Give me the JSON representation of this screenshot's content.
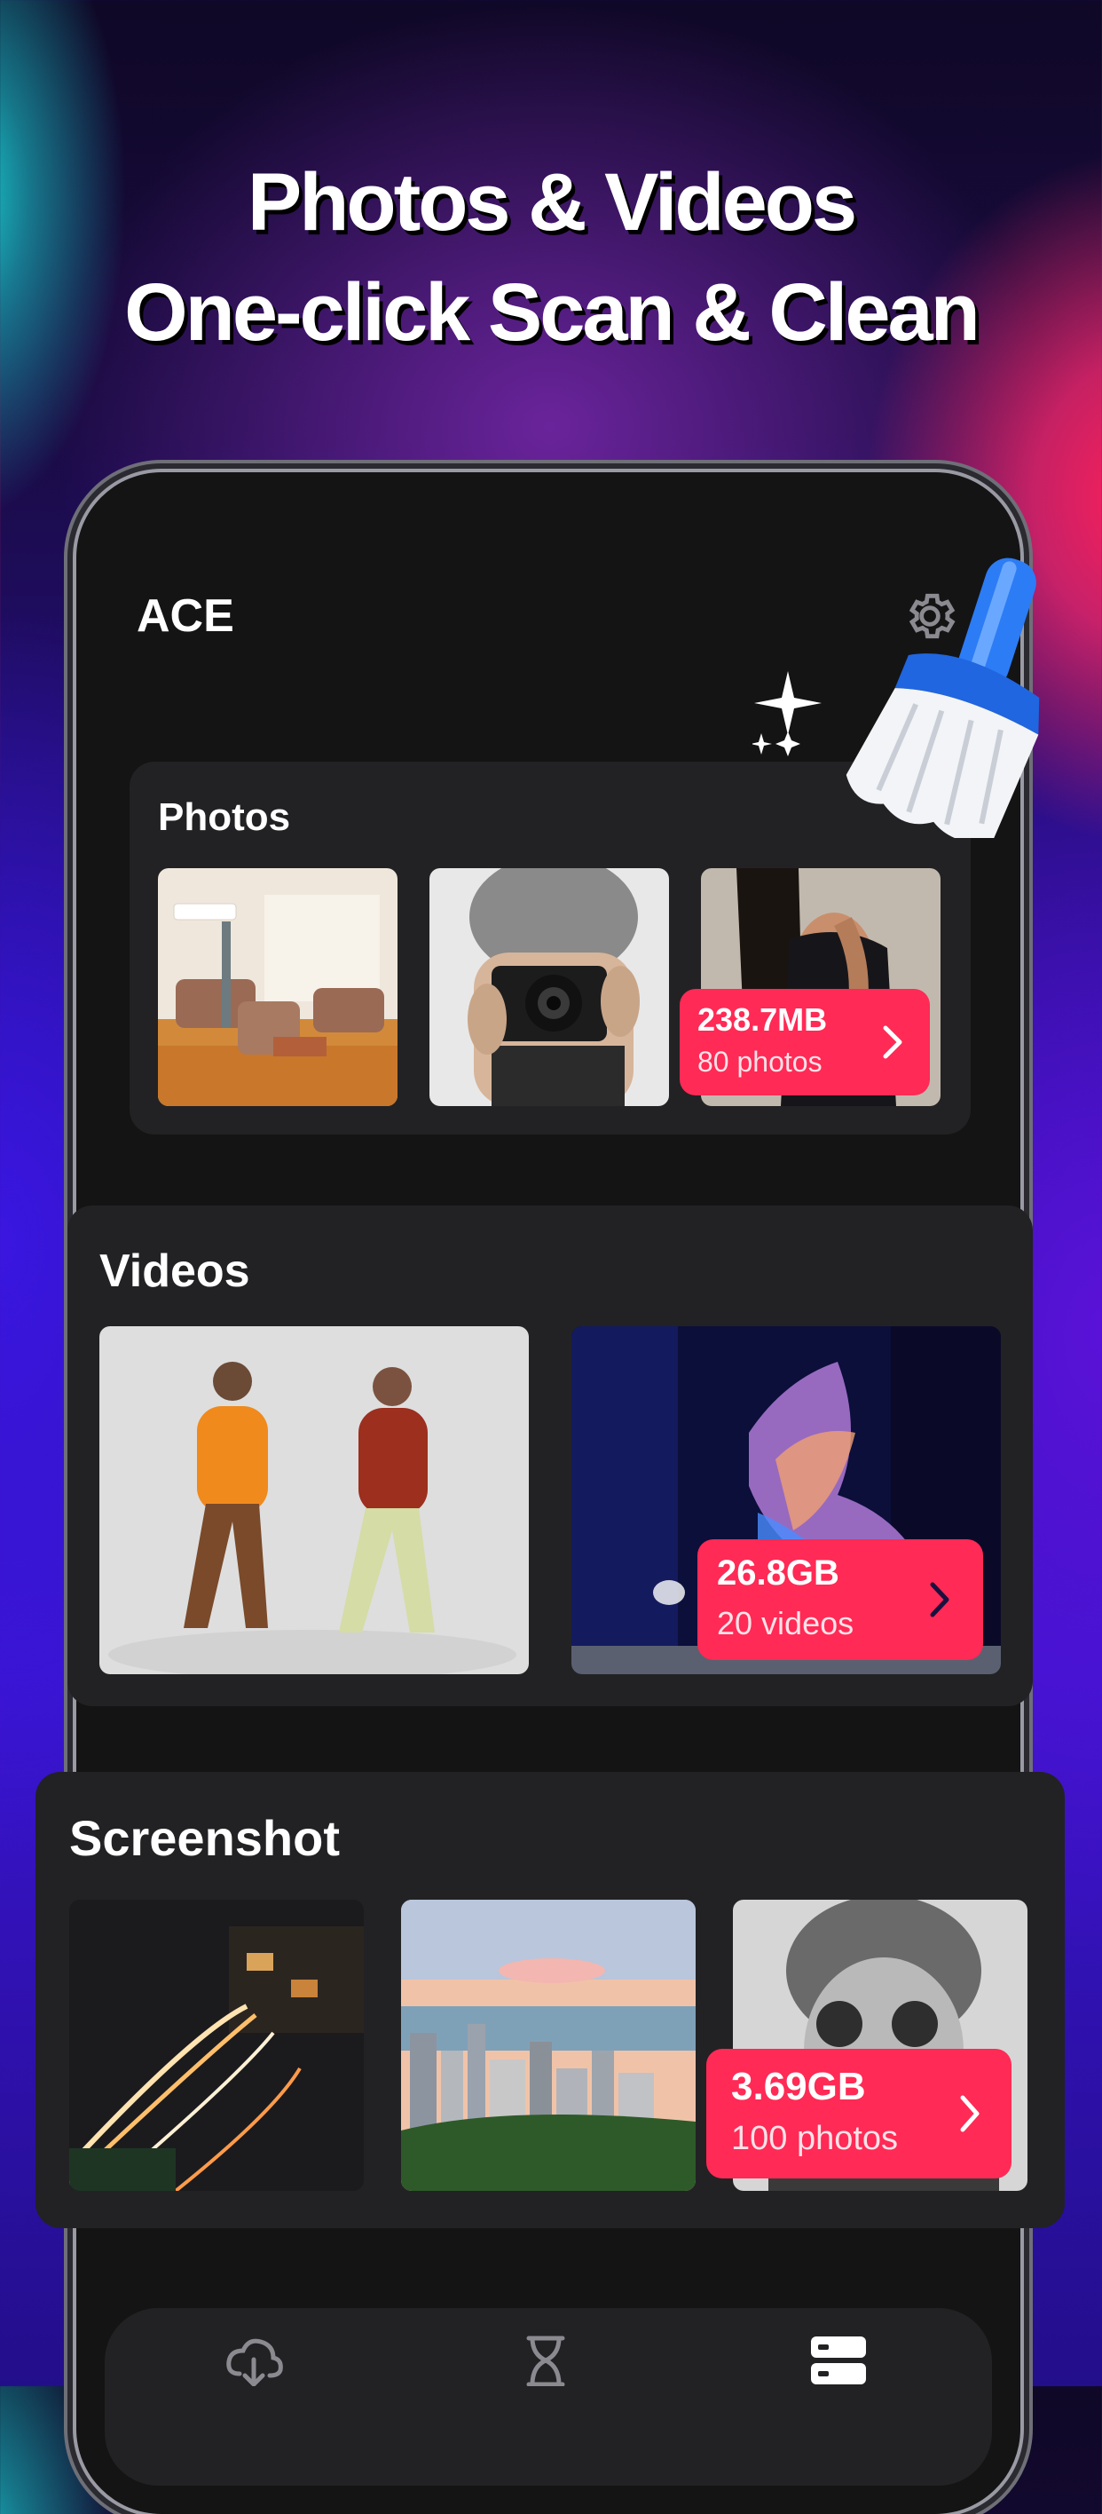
{
  "promo": {
    "line1": "Photos & Videos",
    "line2": "One-click Scan & Clean"
  },
  "app": {
    "title": "ACE"
  },
  "photos": {
    "title": "Photos",
    "size": "238.7MB",
    "count": "80 photos",
    "thumbs": [
      "living-room-photo",
      "camera-person-photo",
      "woman-black-dress-photo"
    ]
  },
  "videos": {
    "title": "Videos",
    "size": "26.8GB",
    "count": "20 videos",
    "thumbs": [
      "two-dancers-video",
      "dancer-motion-blur-video"
    ]
  },
  "screenshots": {
    "title": "Screenshot",
    "size": "3.69GB",
    "count": "100 photos",
    "thumbs": [
      "city-night-traffic-screenshot",
      "city-skyline-screenshot",
      "woman-beanie-screenshot"
    ]
  },
  "icons": [
    "settings-gear-icon",
    "broom-icon",
    "sparkle-icon",
    "cloud-download-icon",
    "hourglass-icon",
    "storage-icon",
    "chevron-right-icon"
  ],
  "colors": {
    "accent": "#ff2a55",
    "card": "#222224",
    "screen": "#141414"
  }
}
